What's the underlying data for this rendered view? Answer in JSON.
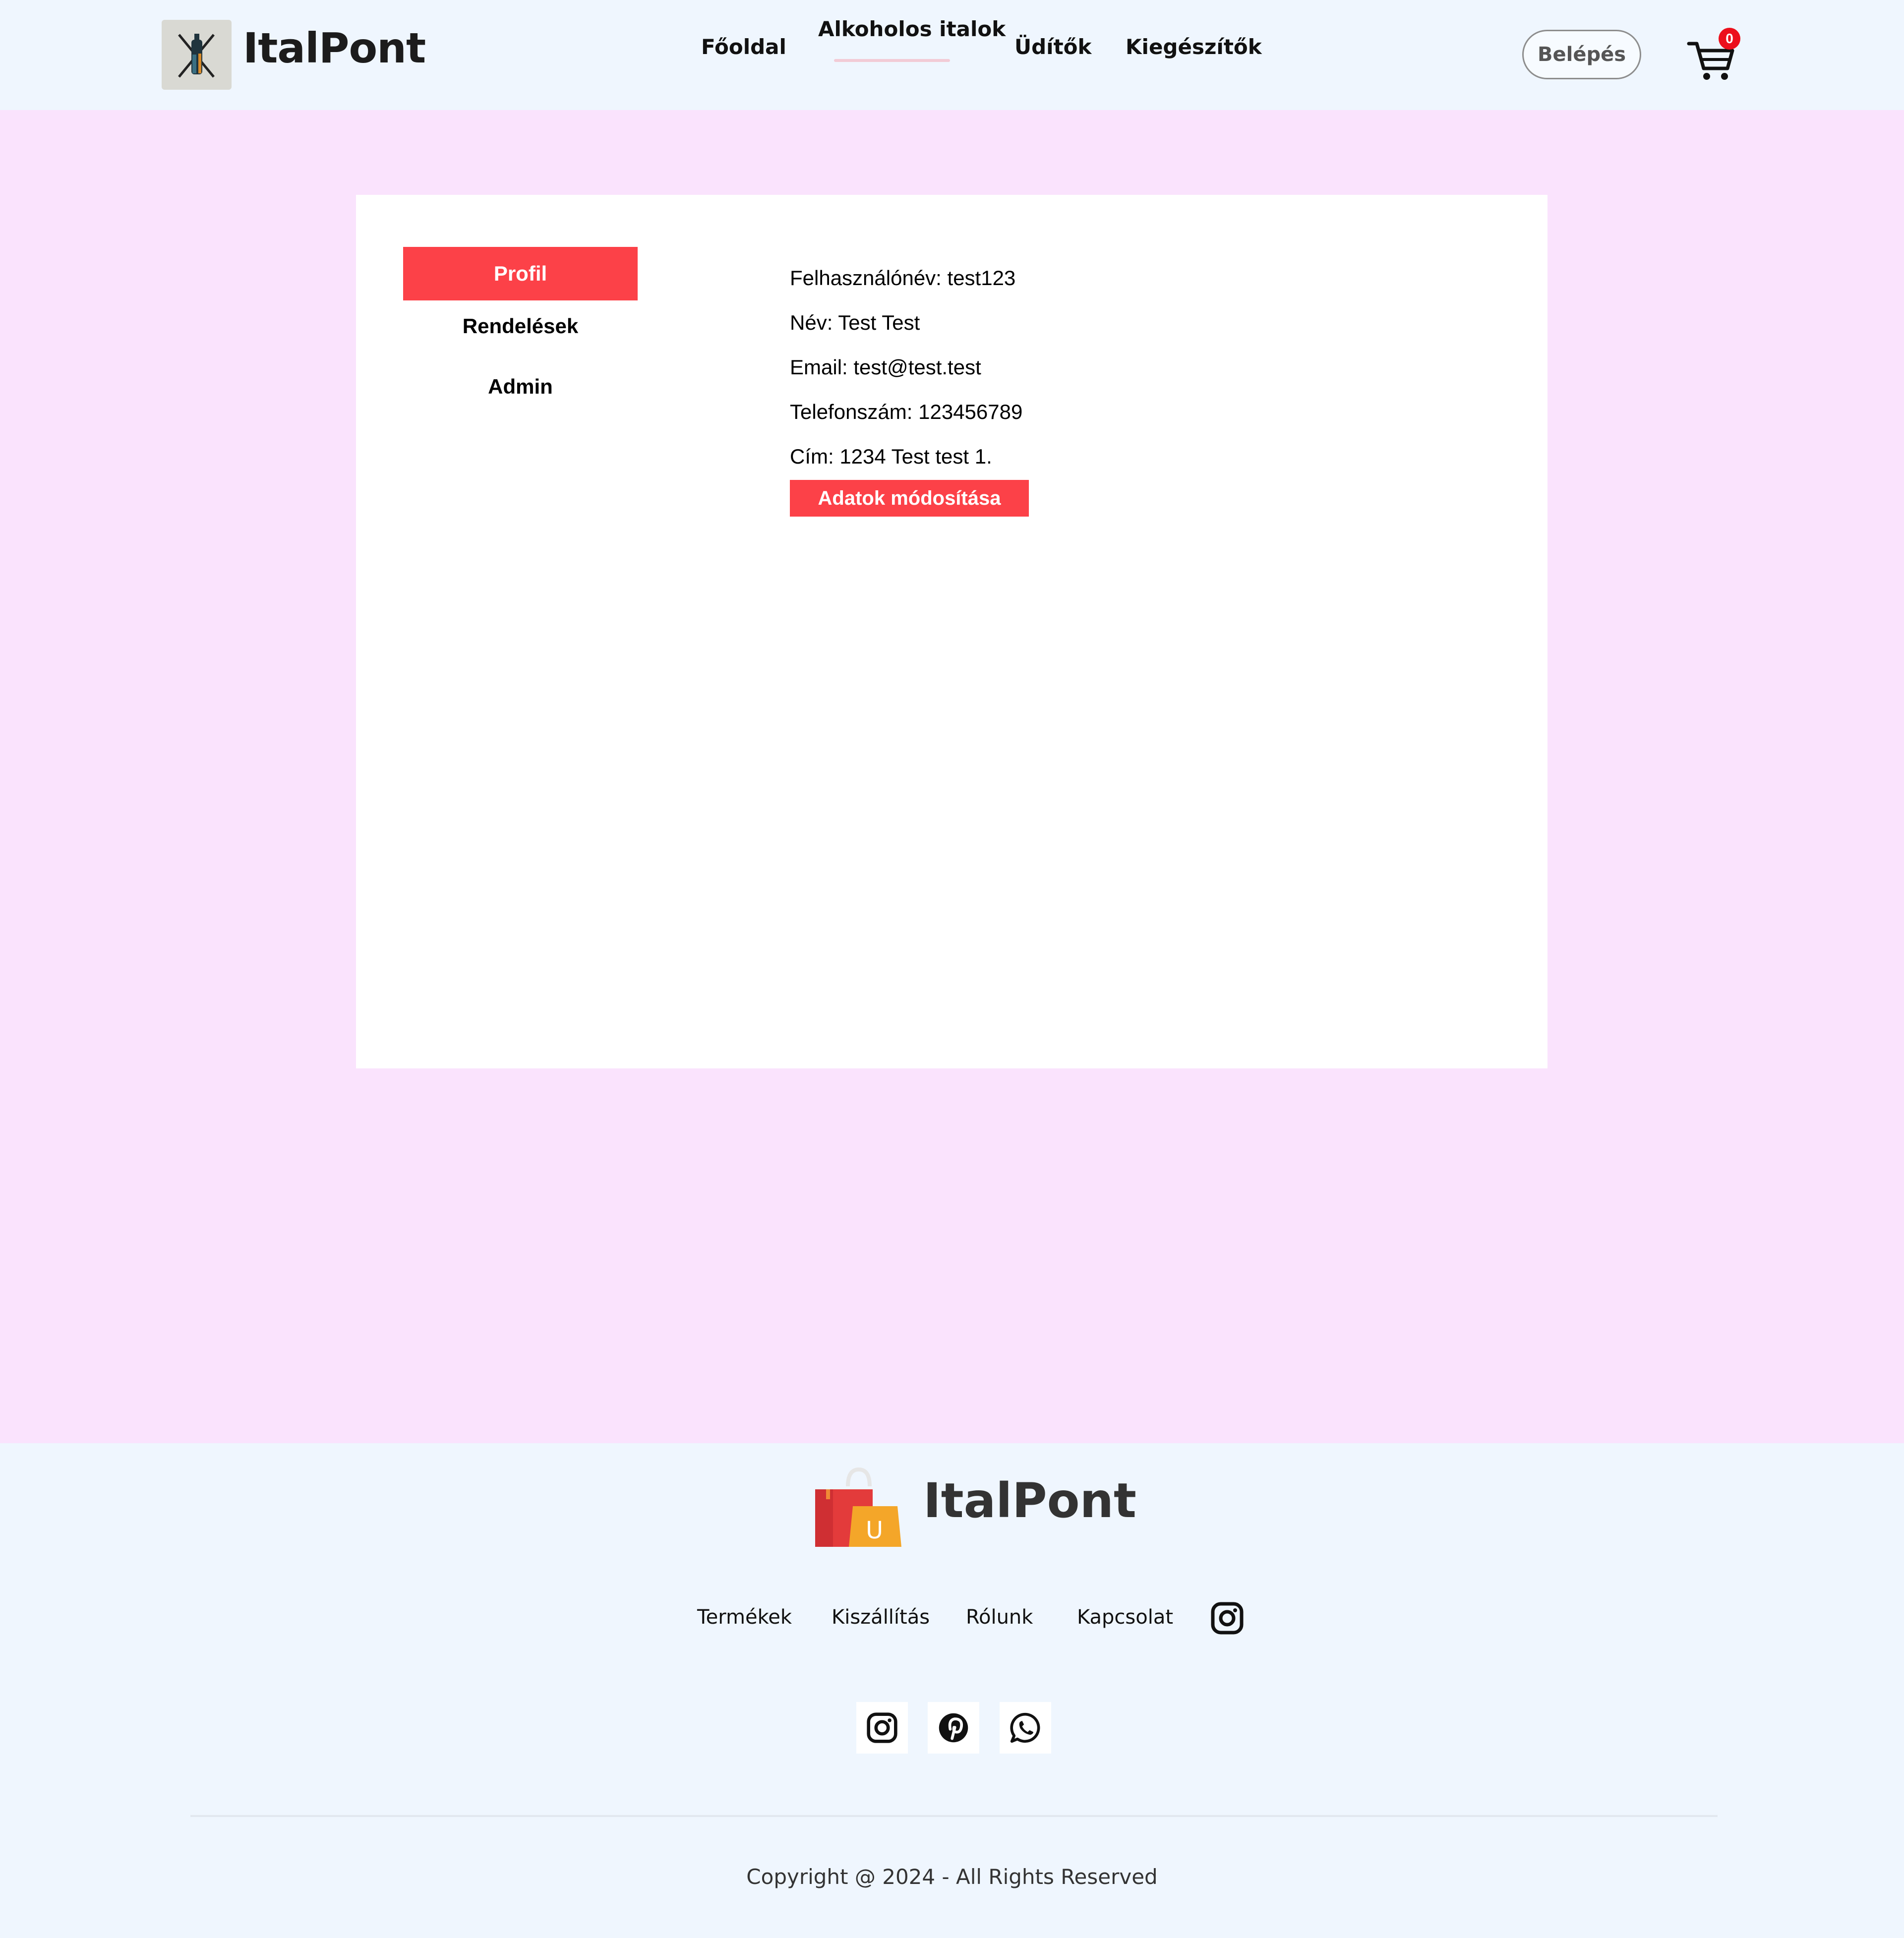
{
  "header": {
    "brand": "ItalPont",
    "nav": [
      "Főoldal",
      "Alkoholos italok",
      "Üdítők",
      "Kiegészítők"
    ],
    "login_label": "Belépés",
    "cart_count": "0"
  },
  "sidebar": {
    "items": [
      "Profil",
      "Rendelések",
      "Admin"
    ]
  },
  "profile": {
    "username": "Felhasználónév: test123",
    "name": "Név: Test Test",
    "email": "Email: test@test.test",
    "phone": "Telefonszám: 123456789",
    "address": "Cím: 1234 Test test 1.",
    "edit_label": "Adatok módosítása"
  },
  "footer": {
    "brand": "ItalPont",
    "logo_letter": "U",
    "links": [
      "Termékek",
      "Kiszállítás",
      "Rólunk",
      "Kapcsolat"
    ],
    "social": [
      "instagram-icon",
      "pinterest-icon",
      "whatsapp-icon"
    ],
    "copyright": "Copyright @ 2024 - All Rights Reserved"
  },
  "colors": {
    "accent": "#fc4148",
    "page_bg": "#fae3fd",
    "header_bg": "#eff6fe"
  }
}
